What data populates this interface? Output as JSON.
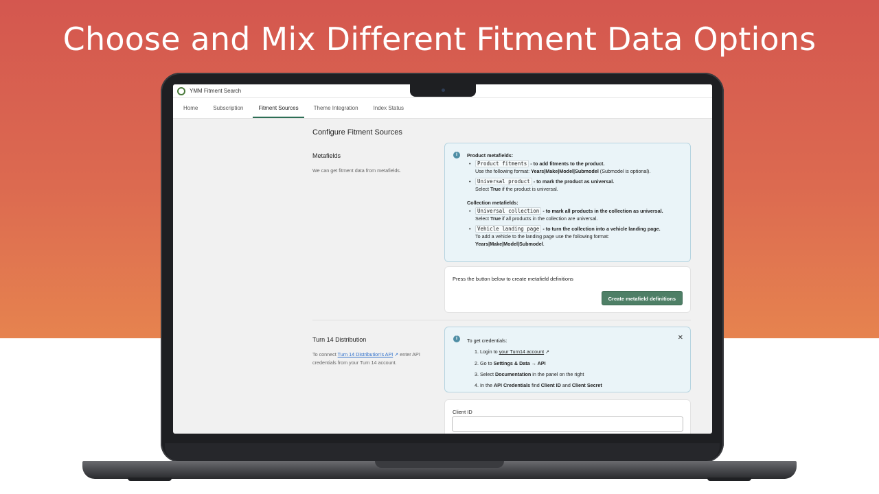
{
  "headline": "Choose and Mix Different Fitment Data Options",
  "app": {
    "title": "YMM Fitment Search",
    "tabs": [
      {
        "label": "Home"
      },
      {
        "label": "Subscription"
      },
      {
        "label": "Fitment Sources"
      },
      {
        "label": "Theme Integration"
      },
      {
        "label": "Index Status"
      }
    ],
    "active_tab": "Fitment Sources"
  },
  "page": {
    "title": "Configure Fitment Sources",
    "metafields": {
      "title": "Metafields",
      "description": "We can get fitment data from metafields.",
      "info": {
        "product_heading": "Product metafields:",
        "product_items": [
          {
            "code": "Product fitments",
            "desc": "- to add fitments to the product.",
            "note_pre": "Use the following format: ",
            "note_strong": "Years|Make|Model|Submodel",
            "note_post": " (Submodel is optional)."
          },
          {
            "code": "Universal product",
            "desc": "- to mark the product as universal.",
            "note_pre": "Select ",
            "note_strong": "True",
            "note_post": " if the product is universal."
          }
        ],
        "collection_heading": "Collection metafields:",
        "collection_items": [
          {
            "code": "Universal collection",
            "desc": "- to mark all products in the collection as universal.",
            "note_pre": "Select ",
            "note_strong": "True",
            "note_post": " if all products in the collection are universal."
          },
          {
            "code": "Vehicle landing page",
            "desc": "- to turn the collection into a vehicle landing page.",
            "note_pre": "To add a vehicle to the landing page use the following format:",
            "note_strong": "Years|Make|Model|Submodel",
            "note_post": "."
          }
        ]
      },
      "create_card": {
        "text": "Press the button below to create metafield definitions",
        "button": "Create metafield definitions"
      }
    },
    "turn14": {
      "title": "Turn 14 Distribution",
      "desc_pre": "To connect ",
      "desc_link": "Turn 14 Distribution's API",
      "desc_post": " enter API credentials from your Turn 14 account.",
      "info": {
        "heading": "To get credentials:",
        "step1_pre": "1. Login to ",
        "step1_link": "your Turn14 account",
        "step2_pre": "2. Go to ",
        "step2_strong": "Settings & Data → API",
        "step3_pre": "3. Select ",
        "step3_strong": "Documentation",
        "step3_post": " in the panel on the right",
        "step4_pre": "4. In the ",
        "step4_strong1": "API Credentials",
        "step4_mid": " find ",
        "step4_strong2": "Client ID",
        "step4_and": " and ",
        "step4_strong3": "Client Secret"
      },
      "client_id_label": "Client ID",
      "client_id_value": ""
    }
  }
}
